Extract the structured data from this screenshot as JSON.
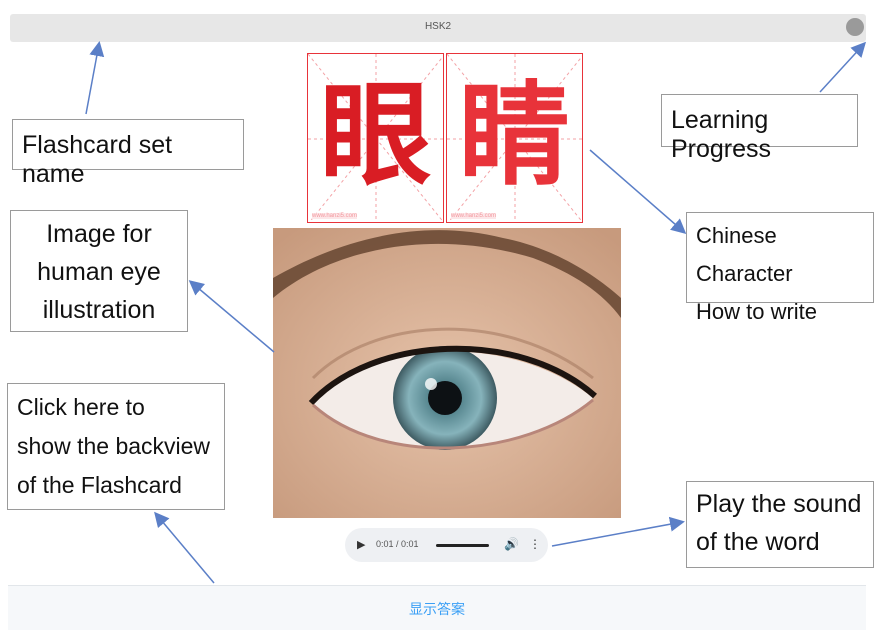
{
  "app": {
    "set_name": "HSK2"
  },
  "card": {
    "characters": [
      "眼",
      "睛"
    ],
    "watermarks": [
      "www.hanzi5.com",
      "www.hanzi5.com"
    ],
    "image": "human-eye-photo"
  },
  "audio": {
    "time": "0:01 / 0:01",
    "play_icon": "play-icon",
    "volume_icon": "volume-icon",
    "more_icon": "more-vertical-icon"
  },
  "footer": {
    "show_answer_label": "显示答案"
  },
  "annotations": {
    "set_name_label": "Flashcard set name",
    "progress_label": "Learning Progress",
    "chars_label_line1": "Chinese Character",
    "chars_label_line2": "How to write",
    "image_label_line1": "Image for",
    "image_label_line2": "human eye",
    "image_label_line3": "illustration",
    "back_label_line1": "Click here to",
    "back_label_line2": "show the backview",
    "back_label_line3": "of the Flashcard",
    "sound_label_line1": "Play the sound",
    "sound_label_line2": "of the word"
  },
  "colors": {
    "accent": "#3a9ff5",
    "char_red": "#e8333a",
    "arrow": "#5b7fc7"
  }
}
